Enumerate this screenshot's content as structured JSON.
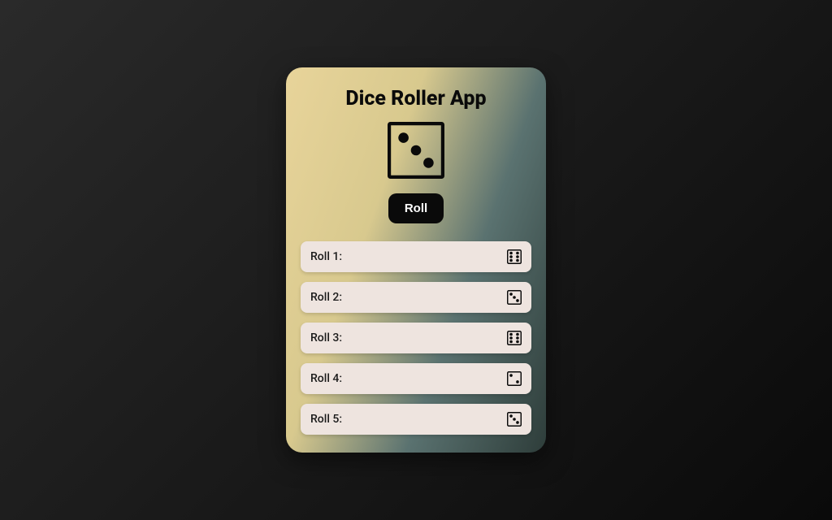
{
  "title": "Dice Roller App",
  "current_face": 3,
  "roll_button": "Roll",
  "history": [
    {
      "label": "Roll 1:",
      "face": 6
    },
    {
      "label": "Roll 2:",
      "face": 3
    },
    {
      "label": "Roll 3:",
      "face": 6
    },
    {
      "label": "Roll 4:",
      "face": 2
    },
    {
      "label": "Roll 5:",
      "face": 3
    }
  ],
  "colors": {
    "card_gradient_from": "#e8d49a",
    "card_gradient_to": "#2e3d3a",
    "button_bg": "#0a0a0a",
    "item_bg": "#eee4df"
  }
}
